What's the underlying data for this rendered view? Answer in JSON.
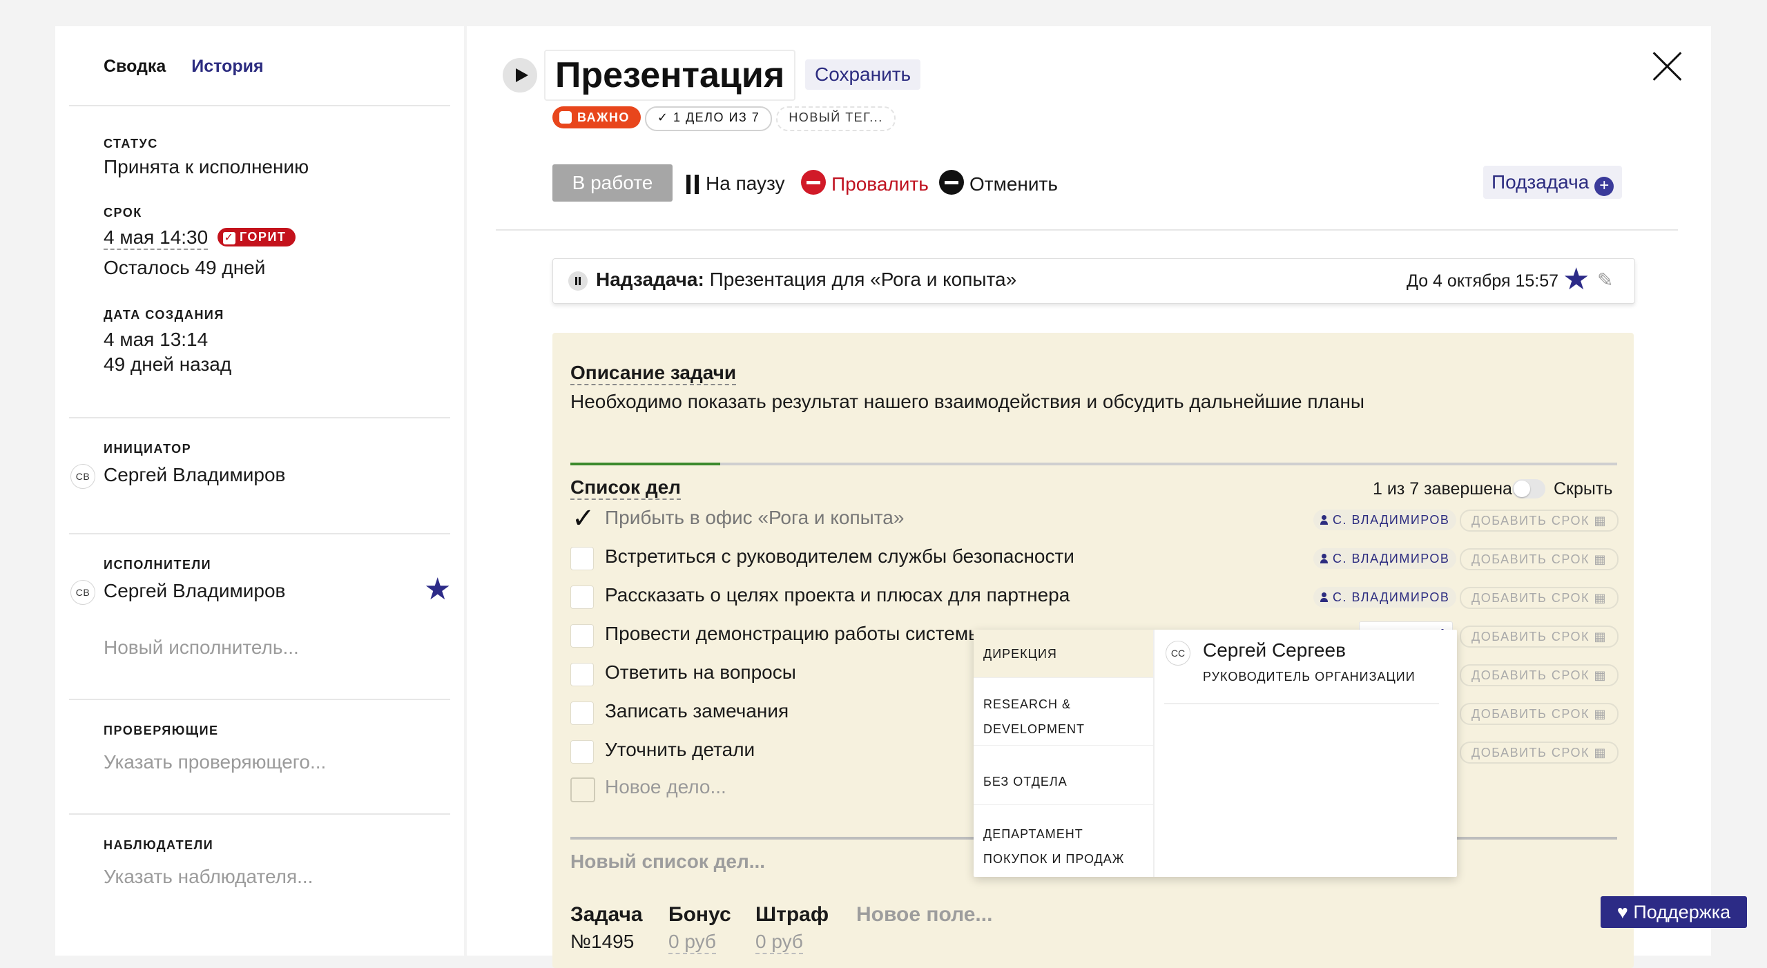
{
  "left": {
    "tabs": {
      "summary": "Сводка",
      "history": "История"
    },
    "status": {
      "label": "СТАТУС",
      "value": "Принята к исполнению"
    },
    "deadline": {
      "label": "СРОК",
      "date": "4 мая 14:30",
      "badge": "ГОРИТ",
      "remaining": "Осталось 49 дней"
    },
    "created": {
      "label": "ДАТА СОЗДАНИЯ",
      "date": "4 мая 13:14",
      "ago": "49 дней назад"
    },
    "initiator": {
      "label": "ИНИЦИАТОР",
      "initials": "СВ",
      "name": "Сергей Владимиров"
    },
    "performers": {
      "label": "ИСПОЛНИТЕЛИ",
      "initials": "СВ",
      "name": "Сергей Владимиров",
      "new_placeholder": "Новый исполнитель..."
    },
    "reviewers": {
      "label": "ПРОВЕРЯЮЩИЕ",
      "placeholder": "Указать проверяющего..."
    },
    "observers": {
      "label": "НАБЛЮДАТЕЛИ",
      "placeholder": "Указать наблюдателя..."
    }
  },
  "header": {
    "title": "Презентация",
    "save": "Сохранить",
    "tags": {
      "important": "ВАЖНО",
      "todo_progress": "✓ 1 ДЕЛО ИЗ 7",
      "new_tag": "НОВЫЙ ТЕГ..."
    }
  },
  "actions": {
    "status": "В работе",
    "pause": "На паузу",
    "fail": "Провалить",
    "cancel": "Отменить",
    "subtask": "Подзадача"
  },
  "parent": {
    "label": "Надзадача:",
    "name": "Презентация для «Рога и копыта»",
    "due": "До 4 октября 15:57"
  },
  "description": {
    "title": "Описание задачи",
    "text": "Необходимо показать результат нашего взаимодействия и обсудить дальнейшие планы"
  },
  "checklist": {
    "title": "Список дел",
    "count": "1 из 7 завершена",
    "hide": "Скрыть",
    "progress_fraction": 0.143,
    "items": [
      {
        "text": "Прибыть в офис «Рога и копыта»",
        "assignee": "С. ВЛАДИМИРОВ",
        "deadline": "ДОБАВИТЬ СРОК"
      },
      {
        "text": "Встретиться с руководителем службы безопасности",
        "assignee": "С. ВЛАДИМИРОВ",
        "deadline": "ДОБАВИТЬ СРОК"
      },
      {
        "text": "Рассказать о целях проекта и плюсах для партнера",
        "assignee": "С. ВЛАДИМИРОВ",
        "deadline": "ДОБАВИТЬ СРОК"
      },
      {
        "text": "Провести демонстрацию работы системы",
        "deadline": "ДОБАВИТЬ СРОК"
      },
      {
        "text": "Ответить на вопросы",
        "deadline": "ДОБАВИТЬ СРОК"
      },
      {
        "text": "Записать замечания",
        "deadline": "ДОБАВИТЬ СРОК"
      },
      {
        "text": "Уточнить детали",
        "deadline": "ДОБАВИТЬ СРОК"
      }
    ],
    "new_item": "Новое дело...",
    "new_list": "Новый список дел..."
  },
  "fields": {
    "task_label": "Задача",
    "task_value": "№1495",
    "bonus_label": "Бонус",
    "bonus_value": "0 руб",
    "fine_label": "Штраф",
    "fine_value": "0 руб",
    "new_field": "Новое поле..."
  },
  "dropdown": {
    "departments": [
      "ДИРЕКЦИЯ",
      "RESEARCH & DEVELOPMENT",
      "БЕЗ ОТДЕЛА",
      "ДЕПАРТАМЕНТ ПОКУПОК И ПРОДАЖ"
    ],
    "person": {
      "initials": "СС",
      "name": "Сергей Сергеев",
      "role": "РУКОВОДИТЕЛЬ ОРГАНИЗАЦИИ"
    }
  },
  "support": "Поддержка",
  "colors": {
    "accent": "#2c2b86",
    "important": "#e8461c",
    "danger": "#c4121c",
    "card": "#f6f1de"
  }
}
